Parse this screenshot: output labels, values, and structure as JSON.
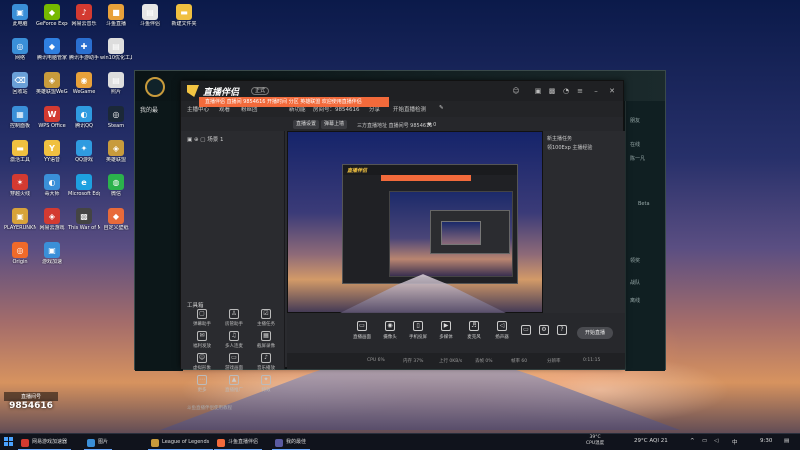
{
  "desktop": {
    "icons": [
      {
        "label": "此电脑",
        "color": "#3a8fd8",
        "glyph": "▣"
      },
      {
        "label": "GeForce Experience",
        "color": "#76b900",
        "glyph": "◆"
      },
      {
        "label": "网易云音乐",
        "color": "#d33a31",
        "glyph": "♪"
      },
      {
        "label": "斗鱼直播",
        "color": "#e8a13a",
        "glyph": "■"
      },
      {
        "label": "斗鱼伴侣",
        "color": "#e6e6e6",
        "glyph": "▤"
      },
      {
        "label": "新建文件夹",
        "color": "#f0c040",
        "glyph": "▬"
      },
      {
        "label": "快速导航",
        "color": "#f0c040",
        "glyph": "▬"
      },
      {
        "label": "网络",
        "color": "#3a8fd8",
        "glyph": "◎"
      },
      {
        "label": "腾讯电脑管家",
        "color": "#2f7fe0",
        "glyph": "◆"
      },
      {
        "label": "腾讯手游助手",
        "color": "#2a6fd0",
        "glyph": "✚"
      },
      {
        "label": "win10优化工具",
        "color": "#dddddd",
        "glyph": "▤"
      },
      {
        "label": "回收站",
        "color": "#6aa0d8",
        "glyph": "⌫"
      },
      {
        "label": "英雄联盟WeGame版",
        "color": "#c89b3c",
        "glyph": "◈"
      },
      {
        "label": "WeGame",
        "color": "#e8a13a",
        "glyph": "◉"
      },
      {
        "label": "照片",
        "color": "#dddddd",
        "glyph": "▤"
      },
      {
        "label": "控制面板",
        "color": "#3a8fd8",
        "glyph": "▦"
      },
      {
        "label": "WPS Office",
        "color": "#d33a31",
        "glyph": "W"
      },
      {
        "label": "腾讯QQ",
        "color": "#2f9be0",
        "glyph": "◐"
      },
      {
        "label": "Steam",
        "color": "#1b2838",
        "glyph": "◎"
      },
      {
        "label": "激活工具",
        "color": "#f0c040",
        "glyph": "▬"
      },
      {
        "label": "YY语音",
        "color": "#f0c040",
        "glyph": "Y"
      },
      {
        "label": "QQ游戏",
        "color": "#2f9be0",
        "glyph": "✦"
      },
      {
        "label": "英雄联盟",
        "color": "#c89b3c",
        "glyph": "◈"
      },
      {
        "label": "穿越火线",
        "color": "#d33a31",
        "glyph": "✶"
      },
      {
        "label": "毒大师",
        "color": "#3a8fd8",
        "glyph": "◐"
      },
      {
        "label": "Microsoft Edge",
        "color": "#1ea0e0",
        "glyph": "e"
      },
      {
        "label": "微信",
        "color": "#2bb24c",
        "glyph": "◍"
      },
      {
        "label": "PLAYERUNKNOWN'S BATTLEGROUNDS",
        "color": "#d8a33a",
        "glyph": "▣"
      },
      {
        "label": "网易云游戏",
        "color": "#d33a31",
        "glyph": "◈"
      },
      {
        "label": "This War of Mine",
        "color": "#444444",
        "glyph": "▩"
      },
      {
        "label": "自定义壁纸",
        "color": "#e86a3a",
        "glyph": "◆"
      },
      {
        "label": "Origin",
        "color": "#f06a2a",
        "glyph": "◎"
      },
      {
        "label": "游戏加速",
        "color": "#3a8fd8",
        "glyph": "▣"
      }
    ]
  },
  "live_id": {
    "label": "直播间号",
    "number": "9854616"
  },
  "lol": {
    "left_banner": "我的最",
    "side_texts": [
      "朋友",
      "在线",
      "陈一凡",
      "Beta",
      "领奖",
      "战队",
      "离线"
    ]
  },
  "live": {
    "title": "直播伴侣",
    "version_badge": "正式",
    "banner": "直播伴侣 直播间 9854616 开播时间 分区 英雄联盟 欢迎使用直播伴侣",
    "toprow": [
      "主播中心",
      "观看",
      "粉丝团",
      "新功能",
      "房间号：9854616",
      "分享",
      "开始直播检测",
      "✎"
    ],
    "room": {
      "pills": [
        "直播设置",
        "弹幕上墙"
      ],
      "text": "三方直播地址 直播间号 9854616",
      "likes": "♥ 0"
    },
    "scene": "场景 1",
    "tools_header": "工具箱",
    "tools": [
      {
        "label": "弹幕助手",
        "glyph": "▢"
      },
      {
        "label": "房管助手",
        "glyph": "♙"
      },
      {
        "label": "主播任务",
        "glyph": "☑"
      },
      {
        "label": "福利发放",
        "glyph": "✉"
      },
      {
        "label": "多人连麦",
        "glyph": "♫"
      },
      {
        "label": "截屏录像",
        "glyph": "▦"
      },
      {
        "label": "虚拟形象",
        "glyph": "☺"
      },
      {
        "label": "游戏画面",
        "glyph": "▭"
      },
      {
        "label": "音乐播放",
        "glyph": "♪"
      },
      {
        "label": "更多",
        "glyph": "⋯"
      },
      {
        "label": "直播推广",
        "glyph": "▲"
      },
      {
        "label": "特效",
        "glyph": "✦"
      }
    ],
    "bottom_tip": "斗鱼直播伴侣使用教程",
    "side_info": [
      "新主播任务",
      "领100Exp 主播经验",
      "",
      "",
      "",
      "",
      ""
    ],
    "controls": [
      {
        "label": "直播画面",
        "glyph": "▭"
      },
      {
        "label": "摄像头",
        "glyph": "◉"
      },
      {
        "label": "手机投屏",
        "glyph": "▯"
      },
      {
        "label": "多媒体",
        "glyph": "▶"
      },
      {
        "label": "麦克风",
        "glyph": "♬"
      },
      {
        "label": "扬声器",
        "glyph": "◁"
      }
    ],
    "start_label": "开始直播",
    "status": [
      "CPU 6%",
      "内存 37%",
      "上行 0KB/s",
      "丢帧 0%",
      "帧率 60",
      "分辨率",
      "0:11:15"
    ]
  },
  "taskbar": {
    "apps": [
      {
        "label": "网易游戏加速器",
        "color": "#d33a31"
      },
      {
        "label": "图片",
        "color": "#3a8fd8"
      },
      {
        "label": "League of Legends",
        "color": "#c89b3c"
      },
      {
        "label": "斗鱼直播伴侣",
        "color": "#f26a3b"
      },
      {
        "label": "我的最佳",
        "color": "#5a5aa0"
      }
    ],
    "cpu_temp": "39°C",
    "cpu_label": "CPU温度",
    "weather": "29°C  AQI 21",
    "lang": "中",
    "time": "9:30"
  }
}
